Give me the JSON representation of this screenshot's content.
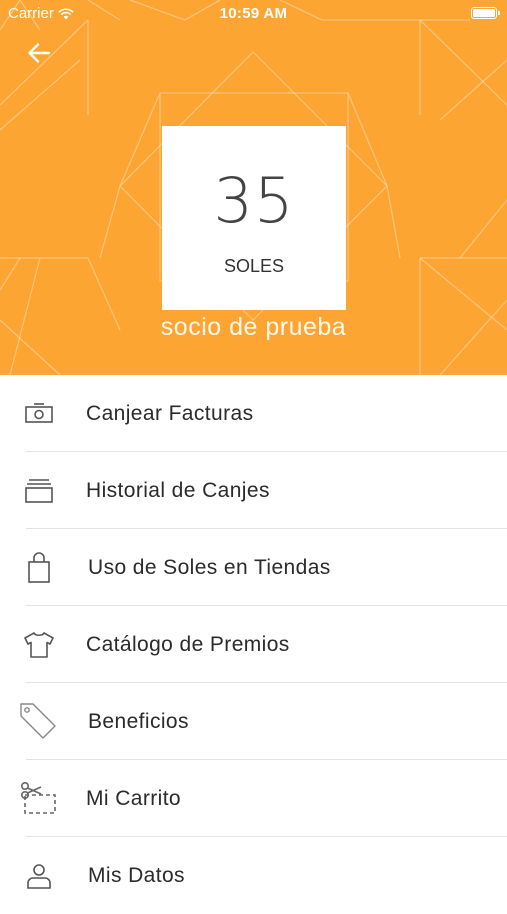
{
  "status_bar": {
    "carrier": "Carrier",
    "time": "10:59 AM",
    "wifi_icon": "wifi-icon",
    "battery_icon": "battery-icon"
  },
  "header": {
    "back_icon": "arrow-left-icon",
    "background_color": "#fca532",
    "balance": {
      "amount": "35",
      "unit": "SOLES"
    },
    "username": "socio de prueba"
  },
  "menu": {
    "items": [
      {
        "label": "Canjear Facturas",
        "icon": "camera-icon"
      },
      {
        "label": "Historial de Canjes",
        "icon": "stack-icon"
      },
      {
        "label": "Uso de Soles en Tiendas",
        "icon": "shopping-bag-icon"
      },
      {
        "label": "Catálogo de Premios",
        "icon": "tshirt-icon"
      },
      {
        "label": "Beneficios",
        "icon": "tag-icon"
      },
      {
        "label": "Mi Carrito",
        "icon": "coupon-scissors-icon"
      },
      {
        "label": "Mis Datos",
        "icon": "user-icon"
      }
    ]
  }
}
